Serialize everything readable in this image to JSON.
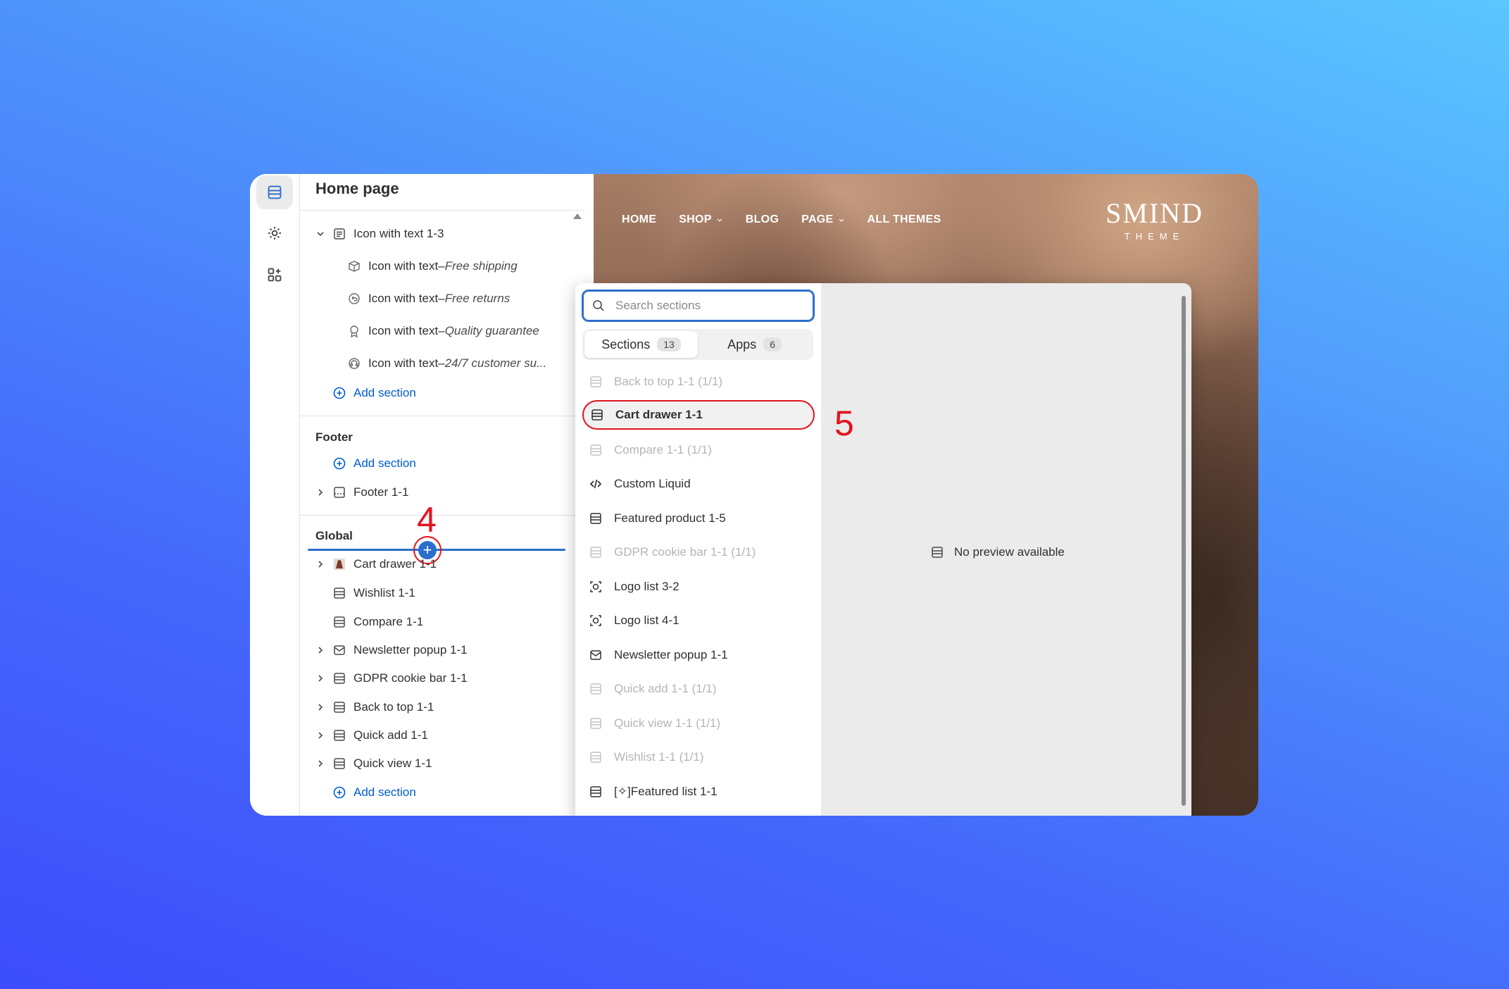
{
  "tree": {
    "title": "Home page",
    "icon_with_text_group": "Icon with text 1-3",
    "blocks": [
      {
        "prefix": "Icon with text",
        "suffix": "Free shipping"
      },
      {
        "prefix": "Icon with text",
        "suffix": "Free returns"
      },
      {
        "prefix": "Icon with text",
        "suffix": "Quality guarantee"
      },
      {
        "prefix": "Icon with text",
        "suffix": "24/7 customer su..."
      }
    ],
    "dash": " – ",
    "add_section": "Add section",
    "footer_label": "Footer",
    "footer_item": "Footer 1-1",
    "global_label": "Global",
    "global_items": [
      "Cart drawer 1-1",
      "Wishlist 1-1",
      "Compare 1-1",
      "Newsletter popup 1-1",
      "GDPR cookie bar 1-1",
      "Back to top 1-1",
      "Quick add 1-1",
      "Quick view 1-1"
    ]
  },
  "preview": {
    "nav": [
      "HOME",
      "SHOP",
      "BLOG",
      "PAGE",
      "ALL THEMES"
    ],
    "logo_main": "SMIND",
    "logo_sub": "THEME"
  },
  "popup": {
    "search_placeholder": "Search sections",
    "tabs": [
      {
        "label": "Sections",
        "count": "13"
      },
      {
        "label": "Apps",
        "count": "6"
      }
    ],
    "items": [
      "Back to top 1-1 (1/1)",
      "Cart drawer 1-1",
      "Compare 1-1 (1/1)",
      "Custom Liquid",
      "Featured product 1-5",
      "GDPR cookie bar 1-1 (1/1)",
      "Logo list 3-2",
      "Logo list 4-1",
      "Newsletter popup 1-1",
      "Quick add 1-1 (1/1)",
      "Quick view 1-1 (1/1)",
      "Wishlist 1-1 (1/1)",
      "[✧]Featured list 1-1"
    ],
    "no_preview": "No preview available"
  },
  "annotations": {
    "step4": "4",
    "step5": "5",
    "highlight_color": "#e3131f"
  },
  "colors": {
    "accent": "#2c6ecb",
    "link": "#005bd3"
  }
}
